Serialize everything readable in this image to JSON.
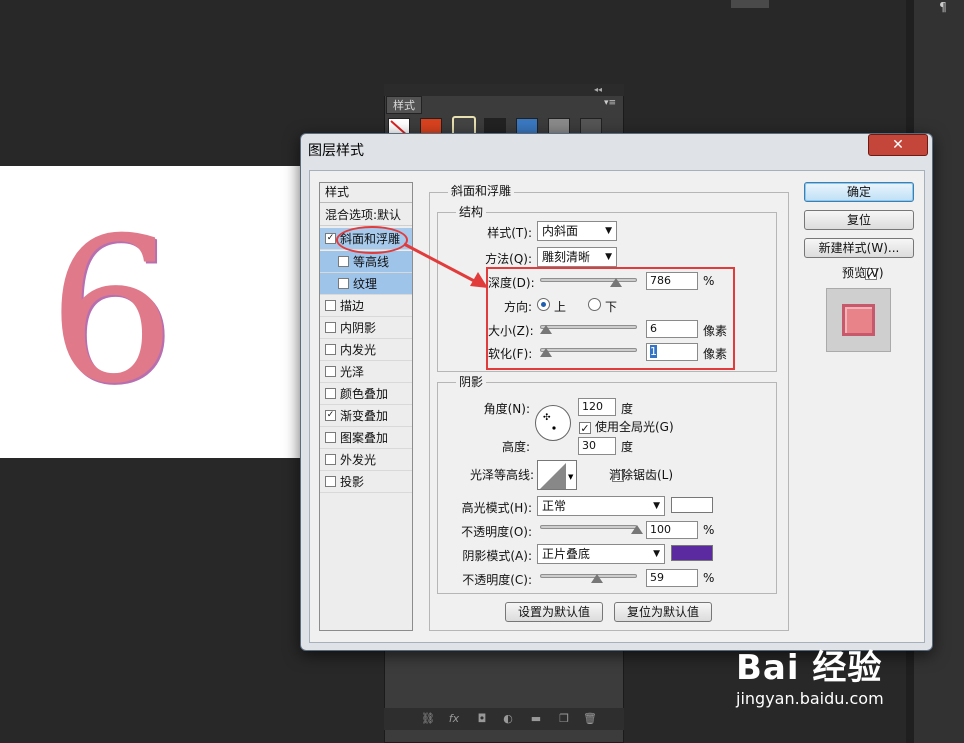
{
  "canvas": {
    "digit": "6"
  },
  "styles_panel": {
    "tab_label": "样式",
    "collapse_icon": "◂◂",
    "menu_icon": "▾≡"
  },
  "dialog": {
    "title": "图层样式",
    "close_label": "✕",
    "style_list": {
      "header": "样式",
      "blend_options": "混合选项:默认",
      "items": [
        {
          "label": "斜面和浮雕",
          "checked": true,
          "selected": true
        },
        {
          "label": "等高线",
          "checked": false,
          "sub": true
        },
        {
          "label": "纹理",
          "checked": false,
          "sub": true
        },
        {
          "label": "描边",
          "checked": false
        },
        {
          "label": "内阴影",
          "checked": false
        },
        {
          "label": "内发光",
          "checked": false
        },
        {
          "label": "光泽",
          "checked": false
        },
        {
          "label": "颜色叠加",
          "checked": false
        },
        {
          "label": "渐变叠加",
          "checked": true
        },
        {
          "label": "图案叠加",
          "checked": false
        },
        {
          "label": "外发光",
          "checked": false
        },
        {
          "label": "投影",
          "checked": false
        }
      ]
    },
    "bevel": {
      "section_title": "斜面和浮雕",
      "structure_title": "结构",
      "style_label": "样式(T):",
      "style_value": "内斜面",
      "technique_label": "方法(Q):",
      "technique_value": "雕刻清晰",
      "depth_label": "深度(D):",
      "depth_value": "786",
      "depth_unit": "%",
      "direction_label": "方向:",
      "direction_up": "上",
      "direction_down": "下",
      "size_label": "大小(Z):",
      "size_value": "6",
      "size_unit": "像素",
      "soften_label": "软化(F):",
      "soften_value": "1",
      "soften_unit": "像素"
    },
    "shading": {
      "title": "阴影",
      "angle_label": "角度(N):",
      "angle_value": "120",
      "angle_unit": "度",
      "global_light_label": "使用全局光(G)",
      "altitude_label": "高度:",
      "altitude_value": "30",
      "altitude_unit": "度",
      "gloss_contour_label": "光泽等高线:",
      "anti_alias_label": "消除锯齿(L)",
      "highlight_mode_label": "高光模式(H):",
      "highlight_mode_value": "正常",
      "highlight_color": "#ffffff",
      "highlight_opacity_label": "不透明度(O):",
      "highlight_opacity_value": "100",
      "shadow_mode_label": "阴影模式(A):",
      "shadow_mode_value": "正片叠底",
      "shadow_color": "#5b2aa0",
      "shadow_opacity_label": "不透明度(C):",
      "shadow_opacity_value": "59",
      "percent": "%"
    },
    "buttons": {
      "make_default": "设置为默认值",
      "reset_default": "复位为默认值",
      "ok": "确定",
      "reset": "复位",
      "new_style": "新建样式(W)...",
      "preview_label": "预览(V)"
    }
  },
  "watermark": {
    "main": "Bai 经验",
    "sub": "jingyan.baidu.com"
  }
}
